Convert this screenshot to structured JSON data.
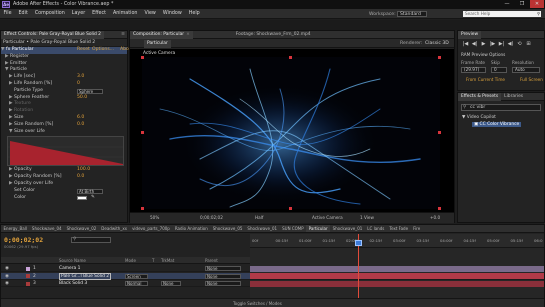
{
  "window": {
    "title": "Adobe After Effects - Color Vibrance.aep *",
    "app_icon": "Ae",
    "minimize": "—",
    "maximize": "❐",
    "close": "✕"
  },
  "menu": {
    "items": [
      "File",
      "Edit",
      "Composition",
      "Layer",
      "Effect",
      "Animation",
      "View",
      "Window",
      "Help"
    ],
    "workspace_label": "Workspace:",
    "workspace_value": "Standard",
    "search_placeholder": "Search Help"
  },
  "effect_controls": {
    "tab_label": "Effect Controls: Pale Gray-Royal Blue Solid 2",
    "tab_menu": "≡",
    "subheader": "Particular • Pale Gray-Royal Blue Solid 2",
    "effect_name": "Particular",
    "effect_links": [
      "Reset",
      "Options...",
      "Abo"
    ],
    "rows": [
      {
        "label": "Register",
        "indent": 1,
        "tw": "▶"
      },
      {
        "label": "Emitter",
        "indent": 1,
        "tw": "▶"
      },
      {
        "label": "Particle",
        "indent": 1,
        "tw": "▼"
      },
      {
        "label": "Life [sec]",
        "indent": 2,
        "tw": "▶",
        "value": "3.0"
      },
      {
        "label": "Life Random [%]",
        "indent": 2,
        "tw": "▶",
        "value": "0"
      },
      {
        "label": "Particle Type",
        "indent": 2,
        "tw": "",
        "dropdown": "Sphere"
      },
      {
        "label": "Sphere Feather",
        "indent": 2,
        "tw": "▶",
        "value": "50.0"
      },
      {
        "label": "Texture",
        "indent": 2,
        "tw": "▶",
        "dim": true
      },
      {
        "label": "Rotation",
        "indent": 2,
        "tw": "▶",
        "dim": true
      },
      {
        "label": "Size",
        "indent": 2,
        "tw": "▶",
        "value": "6.0"
      },
      {
        "label": "Size Random [%]",
        "indent": 2,
        "tw": "▶",
        "value": "0.0"
      },
      {
        "label": "Size over Life",
        "indent": 2,
        "tw": "▼"
      }
    ],
    "rows_after_graph": [
      {
        "label": "Opacity",
        "indent": 2,
        "tw": "▶",
        "value": "100.0"
      },
      {
        "label": "Opacity Random [%]",
        "indent": 2,
        "tw": "▶",
        "value": "0.0"
      },
      {
        "label": "Opacity over Life",
        "indent": 2,
        "tw": "▶"
      },
      {
        "label": "Set Color",
        "indent": 2,
        "tw": "",
        "dropdown": "At Birth"
      },
      {
        "label": "Color",
        "indent": 2,
        "tw": "",
        "swatch": true
      }
    ],
    "graph_color": "#a8232e"
  },
  "composition": {
    "tabs": [
      "Composition: Particular",
      "Footage: Shockwave_Frm_02.mp4"
    ],
    "subtab": "Particular",
    "renderer_label": "Renderer:",
    "renderer_value": "Classic 3D",
    "camera_label": "Active Camera",
    "footer": {
      "zoom": "50%",
      "timecode": "0;00;02;02",
      "resolution": "Half",
      "view": "Active Camera",
      "views": "1 View",
      "exposure": "+0.0"
    }
  },
  "preview": {
    "tab_label": "Preview",
    "controls": [
      "|◀",
      "◀|",
      "▶",
      "|▶",
      "▶|",
      "◀)",
      "⟲",
      "⊞"
    ],
    "ram_options": "RAM Preview Options",
    "frame_rate_label": "Frame Rate",
    "skip_label": "Skip",
    "resolution_label": "Resolution",
    "frame_rate_value": "(29.97)",
    "skip_value": "0",
    "resolution_value": "Auto",
    "from_current": "From Current Time",
    "full_screen": "Full Screen"
  },
  "effects_presets": {
    "tabs": [
      "Effects & Presets",
      "Libraries"
    ],
    "search_value": "cc vibr",
    "category": "Video Copilot",
    "selected_item": "CC Color Vibrance"
  },
  "timeline": {
    "tabs": [
      "Energy_Ball",
      "Shockwave_04",
      "Shockwave_02",
      "Deadwith_xx",
      "videvo_parts_700p",
      "Radio Animation",
      "Shockwave_05",
      "Shockwave_01",
      "SUN COMP",
      "Particular",
      "Shockwave_01",
      "LC lands",
      "Text Fade",
      "Fire"
    ],
    "active_tab_index": 9,
    "timecode": "0;00;02;02",
    "framecode": "00062 (29.97 fps)",
    "search_value": "",
    "columns": [
      "Source Name",
      "Mode",
      "T",
      "TrkMat",
      "Parent"
    ],
    "layers": [
      {
        "num": "1",
        "name": "Camera 1",
        "mode": "",
        "trkmat": "",
        "parent": "None",
        "color": "#c8a3d8"
      },
      {
        "num": "2",
        "name": "Pale Gr...l Blue Solid 2",
        "mode": "Screen",
        "trkmat": "",
        "parent": "None",
        "color": "#a83b3b"
      },
      {
        "num": "3",
        "name": "Black Solid 3",
        "mode": "Normal",
        "trkmat": "None",
        "parent": "None",
        "color": "#a83b3b"
      }
    ],
    "ruler_ticks": [
      "00f",
      "00:15f",
      "01:00f",
      "01:15f",
      "02:00f",
      "02:15f",
      "03:00f",
      "03:15f",
      "04:00f",
      "04:15f",
      "05:00f",
      "05:15f",
      "06:0"
    ],
    "track_colors": [
      "#7a6a8a",
      "#b23a48",
      "#8a2f3a"
    ],
    "toggle_label": "Toggle Switches / Modes"
  }
}
